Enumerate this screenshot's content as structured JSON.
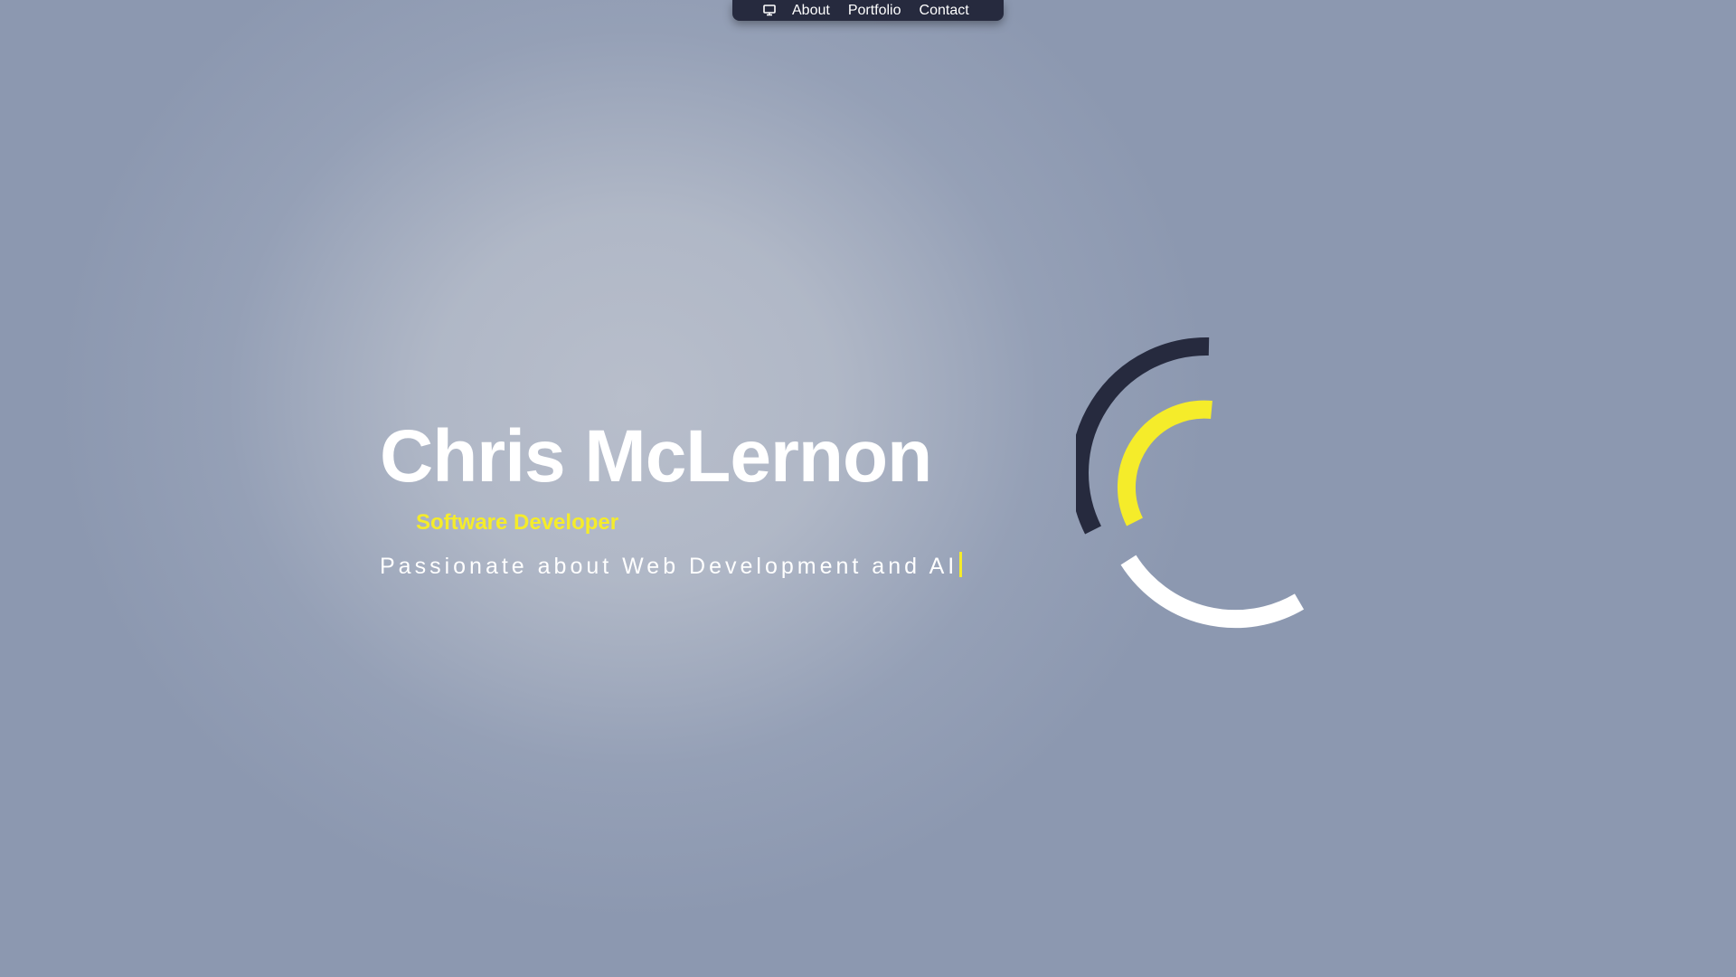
{
  "nav": {
    "icon": "presentation-icon",
    "links": [
      "About",
      "Portfolio",
      "Contact"
    ]
  },
  "hero": {
    "name": "Chris McLernon",
    "role": "Software Developer",
    "tagline": "Passionate about Web Development and AI"
  },
  "colors": {
    "background": "#8c98b0",
    "navbar": "#262a3e",
    "accent": "#f5ec2a",
    "text": "#ffffff",
    "arc_dark": "#262a3e",
    "arc_yellow": "#f5ec2a",
    "arc_white": "#ffffff"
  }
}
